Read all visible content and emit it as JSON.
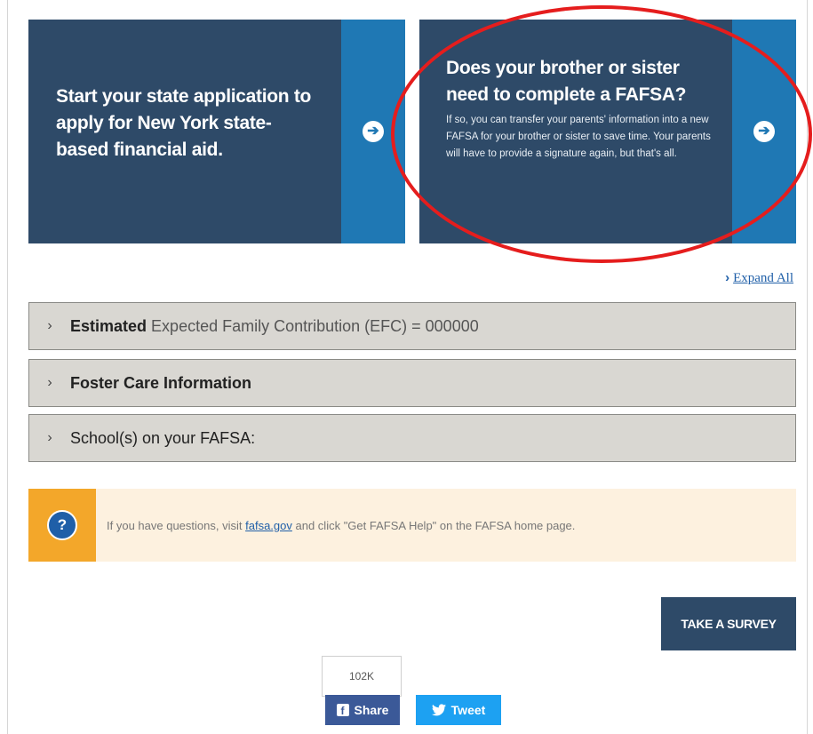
{
  "cards": [
    {
      "title": "Start your state application to apply for New York state-based financial aid."
    },
    {
      "title": "Does your brother or sister need to complete a FAFSA?",
      "body": "If so, you can transfer your parents' information into a new FAFSA for your brother or sister to save time. Your parents will have to provide a signature again, but that's all."
    }
  ],
  "expand_all": "Expand All",
  "accordion": [
    {
      "label_bold": "Estimated",
      "label_rest": "Expected Family Contribution (EFC) = 000000"
    },
    {
      "label_bold": "Foster Care Information",
      "label_rest": ""
    },
    {
      "label_bold": "School(s) on your FAFSA:",
      "label_rest": ""
    }
  ],
  "help": {
    "prefix": "If you have questions, visit",
    "link": "fafsa.gov",
    "suffix": "and click \"Get FAFSA Help\" on the FAFSA home page."
  },
  "survey_label": "TAKE A SURVEY",
  "social": {
    "count": "102K",
    "share": "Share",
    "tweet": "Tweet"
  },
  "colors": {
    "card_bg": "#2e4a68",
    "accent": "#1f78b4",
    "highlight": "#e51d1d",
    "help_bg": "#fdf1df",
    "help_icon_bg": "#f3a72a"
  },
  "icons": [
    "arrow-right-circle-icon",
    "chevron-right-icon",
    "question-circle-icon",
    "facebook-icon",
    "twitter-icon"
  ]
}
